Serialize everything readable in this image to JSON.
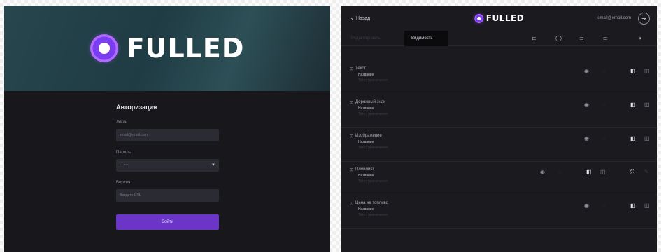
{
  "brand": {
    "name": "FULLED"
  },
  "login": {
    "title": "Авторизация",
    "login_label": "Логин",
    "login_value": "email@email.com",
    "password_label": "Пароль",
    "password_value": "•••••",
    "project_label": "Версия",
    "project_placeholder": "Введите URL",
    "submit_label": "Войти"
  },
  "editor": {
    "back_label": "Назад",
    "user_email": "email@email.com",
    "tabs": [
      {
        "label": "Редактировать"
      },
      {
        "label": "Видимость"
      }
    ],
    "toolbar_icons": [
      "align-left-icon",
      "circle-icon",
      "align-center-icon",
      "align-right-icon",
      "eye-right-icon"
    ],
    "blocks": [
      {
        "title": "Текст",
        "subtitle": "Название",
        "note": "Текст примечания"
      },
      {
        "title": "Дорожный знак",
        "subtitle": "Название",
        "note": "Текст примечания"
      },
      {
        "title": "Изображение",
        "subtitle": "Название",
        "note": "Текст примечания"
      },
      {
        "title": "Плейлист",
        "subtitle": "Название",
        "note": "Текст примечания"
      },
      {
        "title": "Цена на топливо",
        "subtitle": "Название",
        "note": "Текст примечания"
      }
    ]
  },
  "colors": {
    "accent": "#6b35c8",
    "panel": "#1a1a1f",
    "field": "#2b2b33"
  }
}
